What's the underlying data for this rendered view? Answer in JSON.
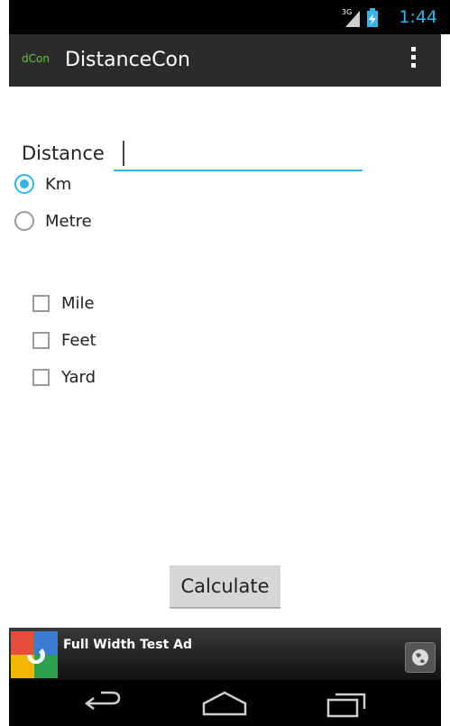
{
  "status": {
    "signal": "3G",
    "time": "1:44"
  },
  "actionbar": {
    "icon_text": "dCon",
    "title": "DistanceCon"
  },
  "form": {
    "distance_label": "Distance",
    "distance_value": "",
    "radios": [
      {
        "label": "Km",
        "checked": true
      },
      {
        "label": "Metre",
        "checked": false
      }
    ],
    "checkboxes": [
      {
        "label": "Mile",
        "checked": false
      },
      {
        "label": "Feet",
        "checked": false
      },
      {
        "label": "Yard",
        "checked": false
      }
    ],
    "calculate_label": "Calculate"
  },
  "ad": {
    "text": "Full Width Test Ad"
  },
  "colors": {
    "accent": "#33b5e5",
    "actionbar": "#2b2b2b",
    "background": "#ffffff"
  },
  "icons": [
    "signal-icon",
    "battery-icon",
    "overflow-menu-icon",
    "google-logo-icon",
    "globe-icon",
    "back-icon",
    "home-icon",
    "recents-icon"
  ]
}
